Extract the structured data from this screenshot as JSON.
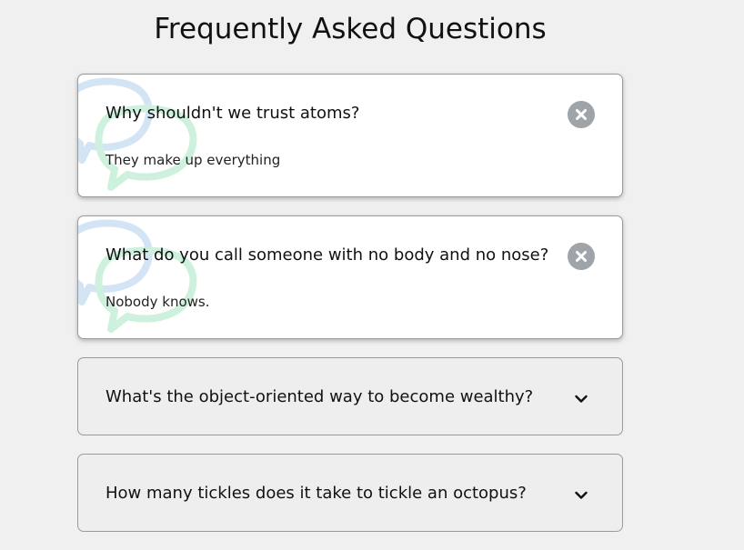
{
  "page": {
    "title": "Frequently Asked Questions"
  },
  "faqs": [
    {
      "question": "Why shouldn't we trust atoms?",
      "answer": "They make up everything",
      "state": "expanded",
      "toggle_icon": "close-icon"
    },
    {
      "question": "What do you call someone with no body and no nose?",
      "answer": "Nobody knows.",
      "state": "expanded",
      "toggle_icon": "close-icon"
    },
    {
      "question": "What's the object-oriented way to become wealthy?",
      "state": "collapsed",
      "toggle_icon": "chevron-down-icon"
    },
    {
      "question": "How many tickles does it take to tickle an octopus?",
      "state": "collapsed",
      "toggle_icon": "chevron-down-icon"
    }
  ],
  "colors": {
    "background": "#f0f0f0",
    "card_active": "#ffffff",
    "card_collapsed": "#eeeeee",
    "close_button": "#9fa4a8",
    "bubble_blue": "#cfe3f5",
    "bubble_green": "#c9f0d9"
  }
}
